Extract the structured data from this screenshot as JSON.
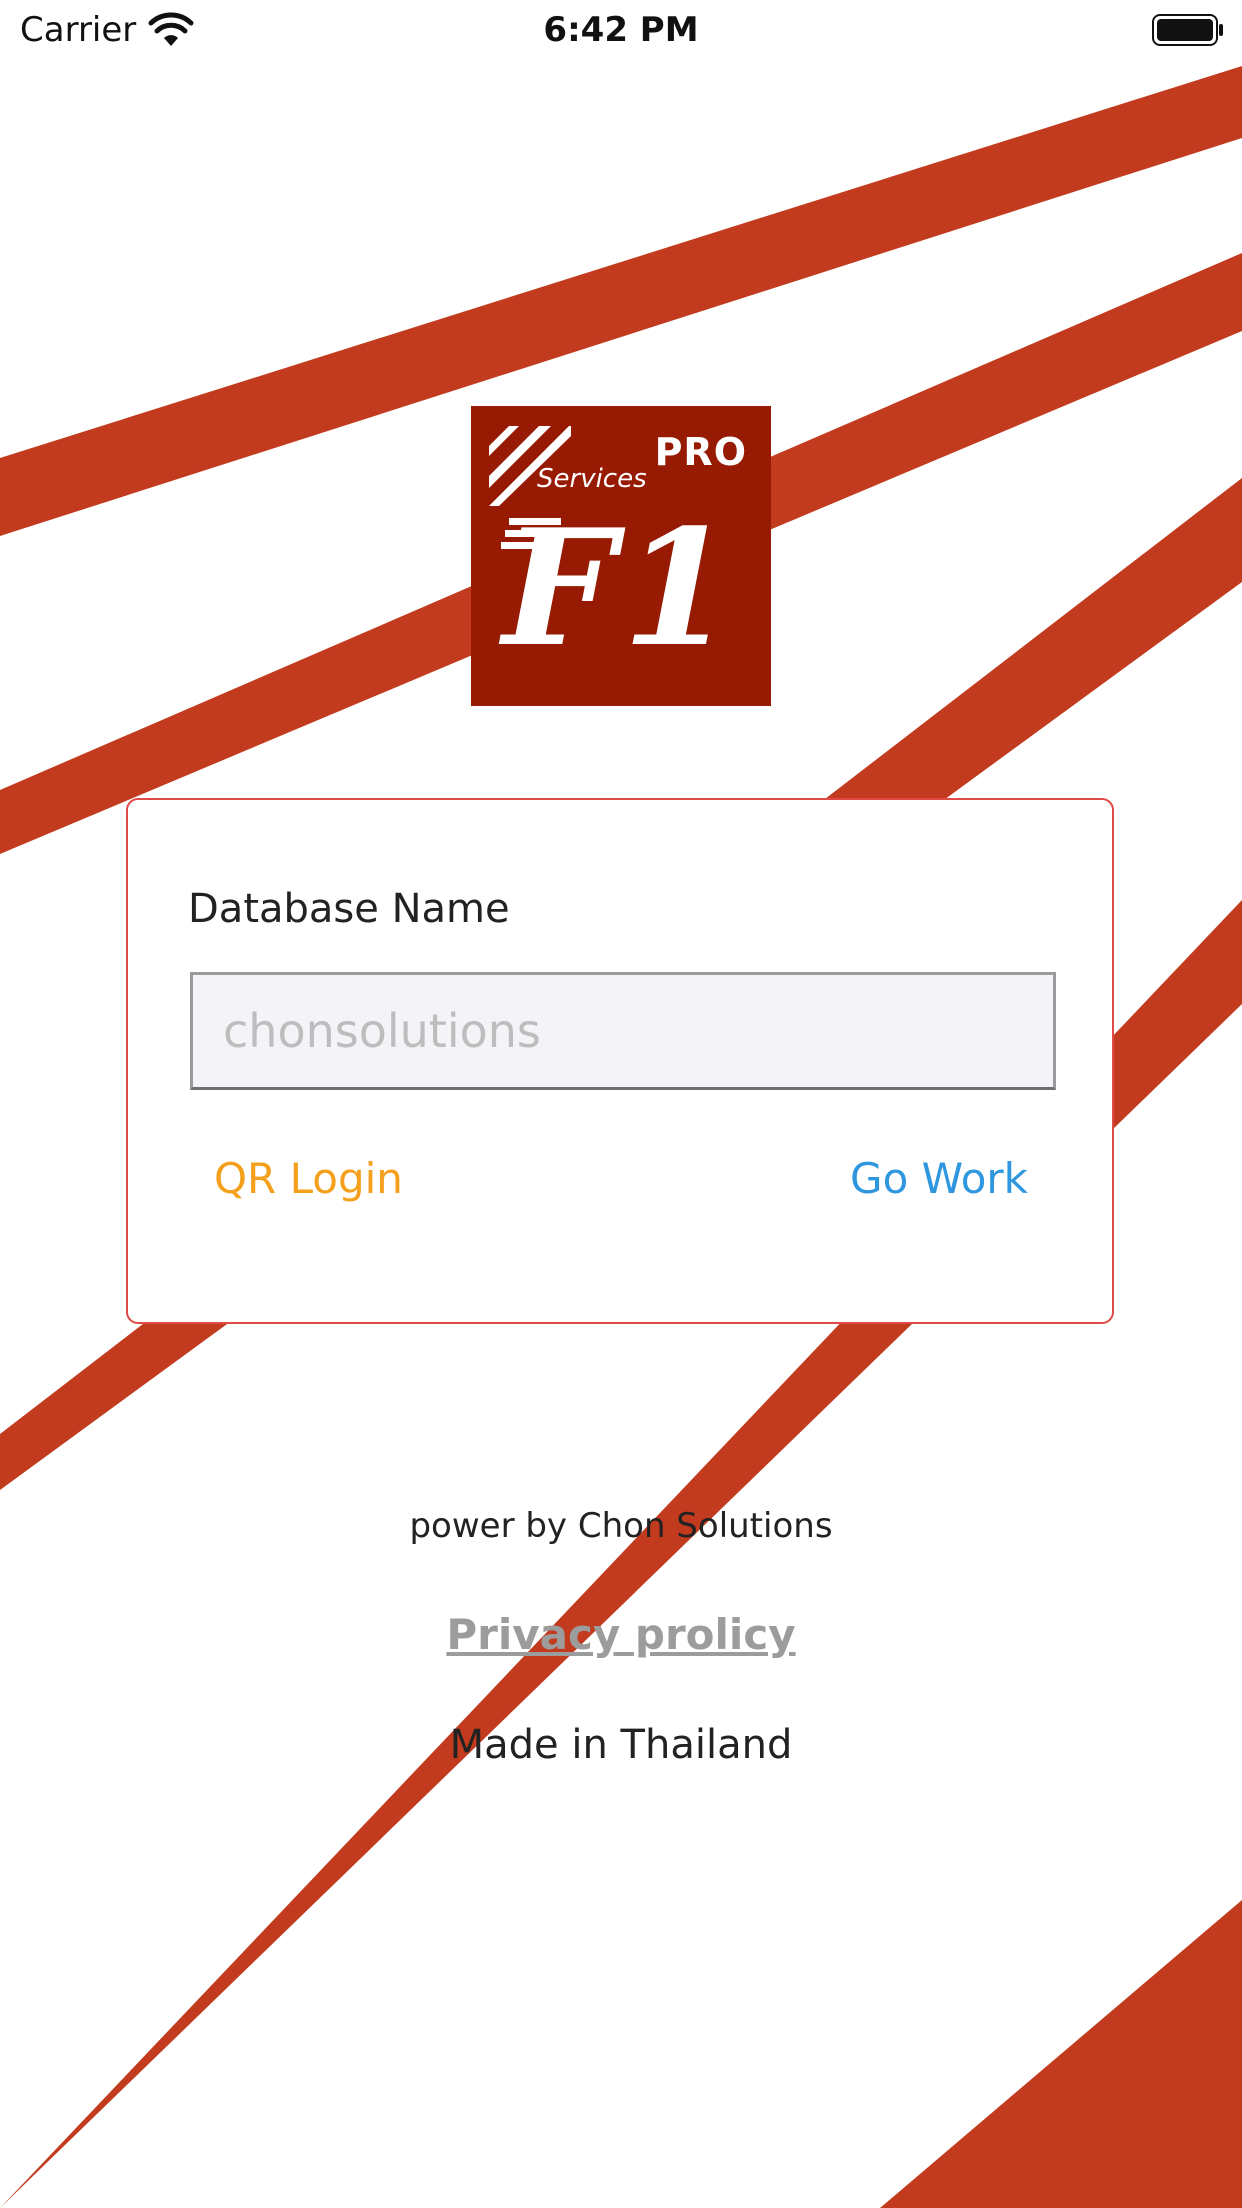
{
  "status_bar": {
    "carrier": "Carrier",
    "time": "6:42 PM",
    "wifi_icon": "wifi-icon",
    "battery_icon": "battery-full-icon"
  },
  "logo": {
    "pro": "PRO",
    "services": "Services",
    "mark": "F1",
    "background_color": "#971a03"
  },
  "form": {
    "label": "Database Name",
    "input_value": "",
    "input_placeholder": "chonsolutions",
    "qr_login_label": "QR Login",
    "go_work_label": "Go Work"
  },
  "footer": {
    "power_by": "power by Chon Solutions",
    "privacy_link": "Privacy prolicy",
    "made_in": "Made in Thailand"
  },
  "colors": {
    "stripe": "#c23b1e",
    "card_border": "#e04a45",
    "qr_login": "#f4a01c",
    "go_work": "#2f97e0"
  }
}
